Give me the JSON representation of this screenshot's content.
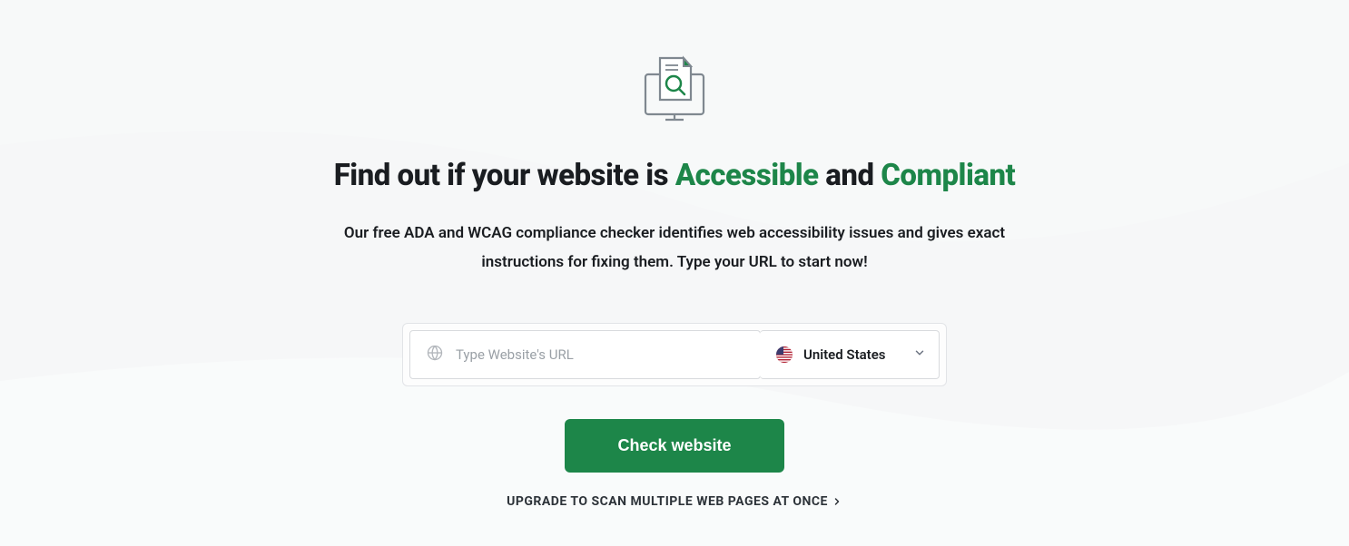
{
  "heading": {
    "part1": "Find out if your website is ",
    "highlight1": "Accessible",
    "part2": " and ",
    "highlight2": "Compliant"
  },
  "subheading": "Our free ADA and WCAG compliance checker identifies web accessibility issues and gives exact instructions for fixing them. Type your URL to start now!",
  "form": {
    "url_placeholder": "Type Website's URL",
    "country_selected": "United States"
  },
  "buttons": {
    "check": "Check website",
    "upgrade": "UPGRADE TO SCAN MULTIPLE WEB PAGES AT ONCE"
  },
  "colors": {
    "accent": "#1d8649",
    "text": "#1a1d21"
  }
}
